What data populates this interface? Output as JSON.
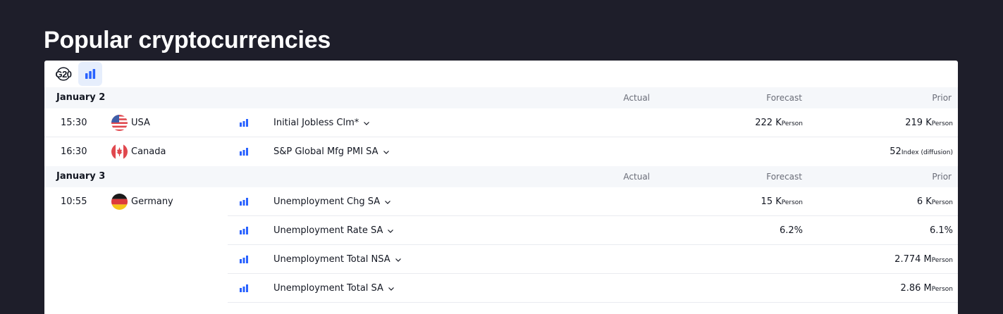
{
  "page": {
    "title": "Popular cryptocurrencies"
  },
  "toolbar": {
    "g20_label": "G20",
    "importance_filter": "bar-chart-icon"
  },
  "groups": [
    {
      "date": "January 2",
      "headers": {
        "actual": "Actual",
        "forecast": "Forecast",
        "prior": "Prior"
      },
      "events": [
        {
          "time": "15:30",
          "country": "USA",
          "flag": "us-flag-icon",
          "name": "Initial Jobless Clm*",
          "forecast": "222 K",
          "forecast_unit": "Person",
          "prior": "219 K",
          "prior_unit": "Person"
        },
        {
          "time": "16:30",
          "country": "Canada",
          "flag": "canada-flag-icon",
          "name": "S&P Global Mfg PMI SA",
          "forecast": "",
          "forecast_unit": "",
          "prior": "52",
          "prior_unit": "Index (diffusion)"
        }
      ]
    },
    {
      "date": "January 3",
      "headers": {
        "actual": "Actual",
        "forecast": "Forecast",
        "prior": "Prior"
      },
      "events": [
        {
          "time": "10:55",
          "country": "Germany",
          "flag": "germany-flag-icon",
          "name": "Unemployment Chg SA",
          "forecast": "15 K",
          "forecast_unit": "Person",
          "prior": "6 K",
          "prior_unit": "Person"
        },
        {
          "time": "",
          "country": "",
          "flag": "",
          "name": "Unemployment Rate SA",
          "forecast": "6.2%",
          "forecast_unit": "",
          "prior": "6.1%",
          "prior_unit": ""
        },
        {
          "time": "",
          "country": "",
          "flag": "",
          "name": "Unemployment Total NSA",
          "forecast": "",
          "forecast_unit": "",
          "prior": "2.774 M",
          "prior_unit": "Person"
        },
        {
          "time": "",
          "country": "",
          "flag": "",
          "name": "Unemployment Total SA",
          "forecast": "",
          "forecast_unit": "",
          "prior": "2.86 M",
          "prior_unit": "Person"
        }
      ]
    }
  ],
  "colors": {
    "background": "#1e1e2a",
    "accent": "#2962ff",
    "header_row": "#f5f7fa"
  }
}
